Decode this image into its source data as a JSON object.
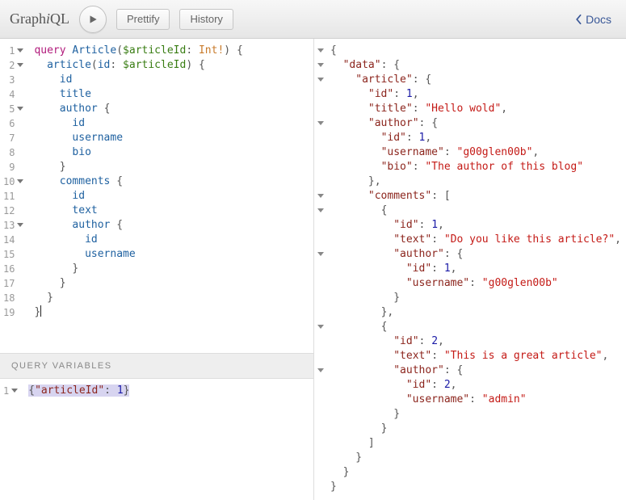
{
  "app": {
    "name_plain": "GraphiQL"
  },
  "toolbar": {
    "prettify": "Prettify",
    "history": "History",
    "docs": "Docs"
  },
  "query_editor": {
    "line_count": 19,
    "tokens": {
      "kw_query": "query",
      "op_name": "Article",
      "var_articleId": "$articleId",
      "type_int_bang": "Int!",
      "field_article": "article",
      "arg_id": "id",
      "f_id": "id",
      "f_title": "title",
      "f_author": "author",
      "f_username": "username",
      "f_bio": "bio",
      "f_comments": "comments",
      "f_text": "text"
    }
  },
  "query_variables": {
    "label": "Query Variables",
    "raw": "{\"articleId\": 1}",
    "prop_articleId": "\"articleId\"",
    "val_1": "1"
  },
  "result": {
    "json": {
      "data": {
        "article": {
          "id": 1,
          "title": "Hello wold",
          "author": {
            "id": 1,
            "username": "g00glen00b",
            "bio": "The author of this blog"
          },
          "comments": [
            {
              "id": 1,
              "text": "Do you like this article?",
              "author": {
                "id": 1,
                "username": "g00glen00b"
              }
            },
            {
              "id": 2,
              "text": "This is a great article",
              "author": {
                "id": 2,
                "username": "admin"
              }
            }
          ]
        }
      }
    },
    "tok": {
      "data": "\"data\"",
      "article": "\"article\"",
      "id": "\"id\"",
      "title": "\"title\"",
      "author": "\"author\"",
      "username": "\"username\"",
      "bio": "\"bio\"",
      "comments": "\"comments\"",
      "text": "\"text\"",
      "v_id1": "1",
      "v_id2": "2",
      "v_title": "\"Hello wold\"",
      "v_user_g": "\"g00glen00b\"",
      "v_bio": "\"The author of this blog\"",
      "v_text1": "\"Do you like this article?\"",
      "v_text2": "\"This is a great article\"",
      "v_admin": "\"admin\""
    }
  }
}
